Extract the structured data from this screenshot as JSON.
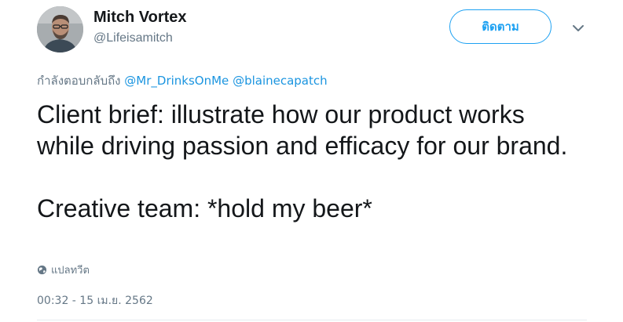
{
  "author": {
    "name": "Mitch Vortex",
    "handle": "@Lifeisamitch"
  },
  "follow_button": {
    "label": "ติดตาม"
  },
  "reply": {
    "prefix": "กำลังตอบกลับถึง",
    "mentions": [
      "@Mr_DrinksOnMe",
      "@blainecapatch"
    ]
  },
  "tweet": {
    "paragraphs": [
      "Client brief: illustrate how our product works while driving passion and efficacy for our brand.",
      "Creative team: *hold my beer*"
    ]
  },
  "translate": {
    "icon": "globe-icon",
    "label": "แปลทวีต"
  },
  "timestamp": "00:32 - 15 เม.ย. 2562",
  "colors": {
    "accent": "#1da1f2",
    "link": "#1b95e0",
    "secondary_text": "#657786",
    "primary_text": "#14171a"
  }
}
